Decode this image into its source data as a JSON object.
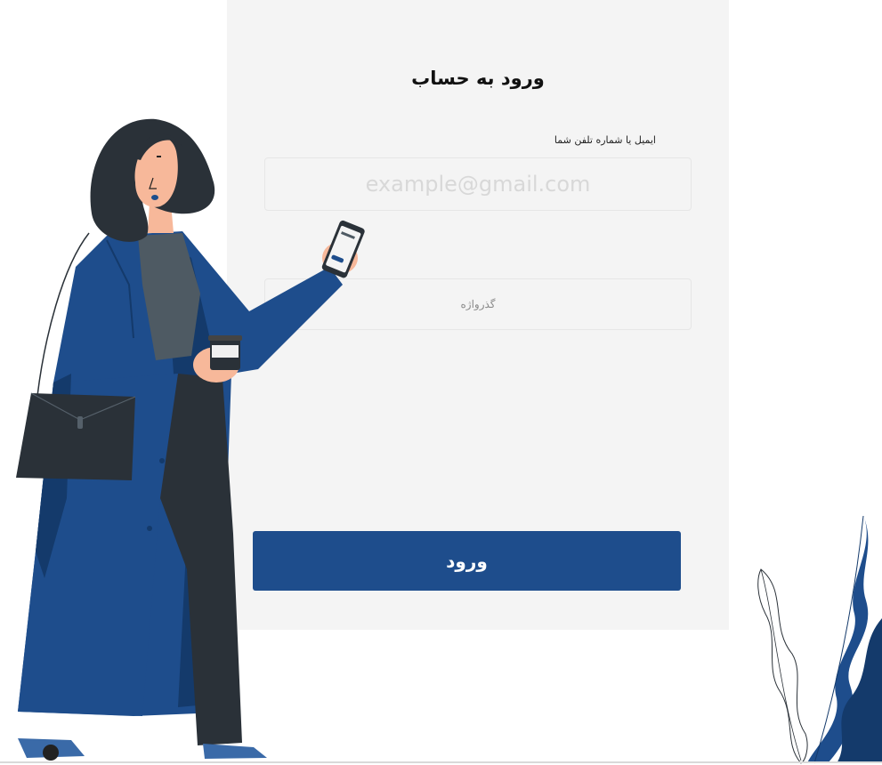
{
  "form": {
    "title": "ورود به حساب",
    "email_label": "ایمیل یا شماره تلفن شما",
    "email_placeholder": "example@gmail.com",
    "password_placeholder": "گذرواژه",
    "submit_label": "ورود"
  },
  "colors": {
    "primary": "#1e4d8c",
    "card_background": "#f4f4f4",
    "page_background": "#ffffff"
  },
  "illustrations": {
    "woman": "woman-with-phone-illustration",
    "plant": "plant-leaves-illustration"
  }
}
